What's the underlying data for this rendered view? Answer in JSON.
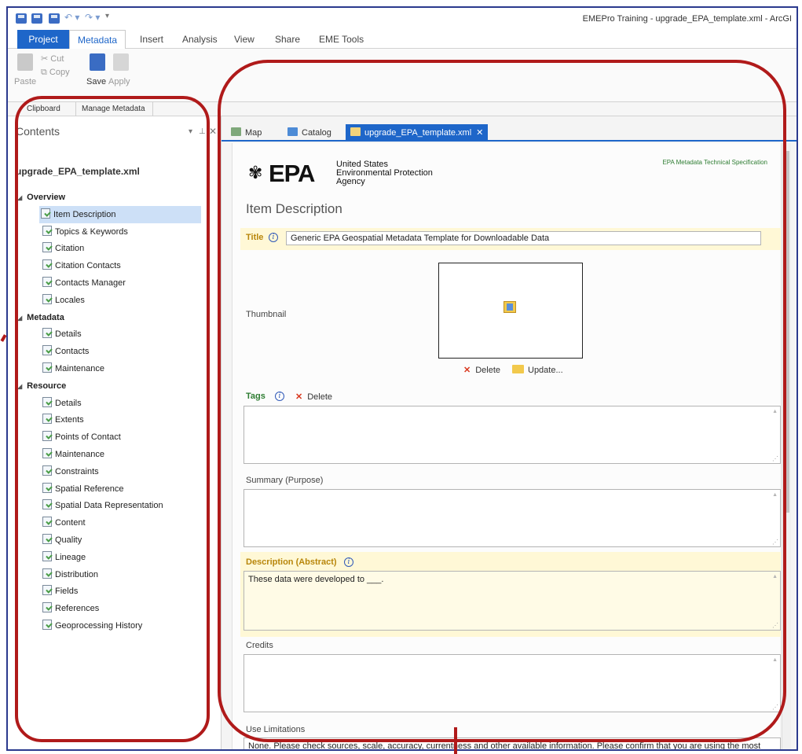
{
  "window": {
    "title": "EMEPro Training - upgrade_EPA_template.xml - ArcGI"
  },
  "ribbon": {
    "tabs": [
      "Project",
      "Metadata",
      "Insert",
      "Analysis",
      "View",
      "Share",
      "EME Tools"
    ],
    "active_tab": "Metadata",
    "clipboard": {
      "paste_label": "Paste",
      "cut_label": "Cut",
      "copy_label": "Copy",
      "group_label": "Clipboard"
    },
    "manage": {
      "save_label": "Save",
      "apply_label": "Apply",
      "group_label": "Manage Metadata"
    }
  },
  "contents": {
    "title": "Contents",
    "file_name": "upgrade_EPA_template.xml",
    "sections": [
      {
        "label": "Overview",
        "items": [
          "Item Description",
          "Topics & Keywords",
          "Citation",
          "Citation Contacts",
          "Contacts Manager",
          "Locales"
        ]
      },
      {
        "label": "Metadata",
        "items": [
          "Details",
          "Contacts",
          "Maintenance"
        ]
      },
      {
        "label": "Resource",
        "items": [
          "Details",
          "Extents",
          "Points of Contact",
          "Maintenance",
          "Constraints",
          "Spatial Reference",
          "Spatial Data Representation",
          "Content",
          "Quality",
          "Lineage",
          "Distribution",
          "Fields",
          "References",
          "Geoprocessing History"
        ]
      }
    ],
    "selected_item": "Item Description"
  },
  "doc_tabs": [
    "Map",
    "Catalog",
    "upgrade_EPA_template.xml"
  ],
  "doc_tabs_active": "upgrade_EPA_template.xml",
  "editor": {
    "logo_word": "EPA",
    "agency_lines": [
      "United States",
      "Environmental Protection",
      "Agency"
    ],
    "spec_link": "EPA Metadata Technical Specification",
    "section_title": "Item Description",
    "title_label": "Title",
    "title_value": "Generic EPA Geospatial Metadata Template for Downloadable Data",
    "thumbnail_label": "Thumbnail",
    "thumb_delete_label": "Delete",
    "thumb_update_label": "Update...",
    "tags_label": "Tags",
    "tags_delete_label": "Delete",
    "tags_value": "",
    "summary_label": "Summary (Purpose)",
    "summary_value": "",
    "description_label": "Description (Abstract)",
    "description_value": "These data were developed to ___.",
    "credits_label": "Credits",
    "credits_value": "",
    "use_limitations_label": "Use Limitations",
    "use_limitations_value": "None. Please check sources, scale, accuracy, currentness and other available information. Please confirm that you are using the most recent copy of both data and metadata. Acknowledgement of the EPA would be appreciated."
  },
  "colors": {
    "accent": "#1e66c9",
    "annotation": "#b01a1a",
    "required_highlight": "#fff8d6"
  }
}
